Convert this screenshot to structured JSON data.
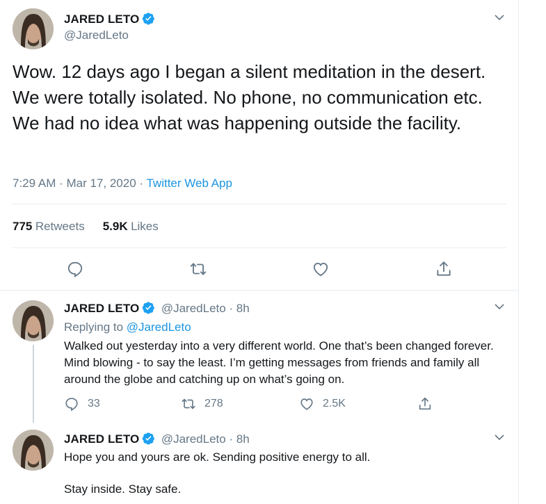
{
  "main_tweet": {
    "name": "JARED LETO",
    "handle": "@JaredLeto",
    "text": "Wow. 12 days ago I began a silent meditation in the desert. We were totally isolated. No phone, no communication etc. We had no idea what was happening outside the facility.",
    "time": "7:29 AM · Mar 17, 2020 · ",
    "source": "Twitter Web App",
    "retweets_count": "775",
    "retweets_label": "Retweets",
    "likes_count": "5.9K",
    "likes_label": "Likes"
  },
  "reply1": {
    "name": "JARED LETO",
    "handle_time": "@JaredLeto · 8h",
    "replying_prefix": "Replying to ",
    "replying_handle": "@JaredLeto",
    "text": "Walked out yesterday into a very different world. One that’s been changed forever. Mind blowing - to say the least. I’m getting messages from friends and family all around the globe and catching up on what’s going on.",
    "replies": "33",
    "retweets": "278",
    "likes": "2.5K"
  },
  "reply2": {
    "name": "JARED LETO",
    "handle_time": "@JaredLeto · 8h",
    "text_line1": "Hope you and yours are ok. Sending positive energy to all.",
    "text_line2": "Stay inside. Stay safe."
  },
  "icons": {
    "verified": "verified-badge-icon",
    "chevron": "chevron-down-icon",
    "reply": "reply-icon",
    "retweet": "retweet-icon",
    "like": "heart-icon",
    "share": "share-icon"
  },
  "colors": {
    "accent": "#1da1f2",
    "link": "#1b95e0",
    "secondary_text": "#657786",
    "divider": "#e6ecf0"
  }
}
